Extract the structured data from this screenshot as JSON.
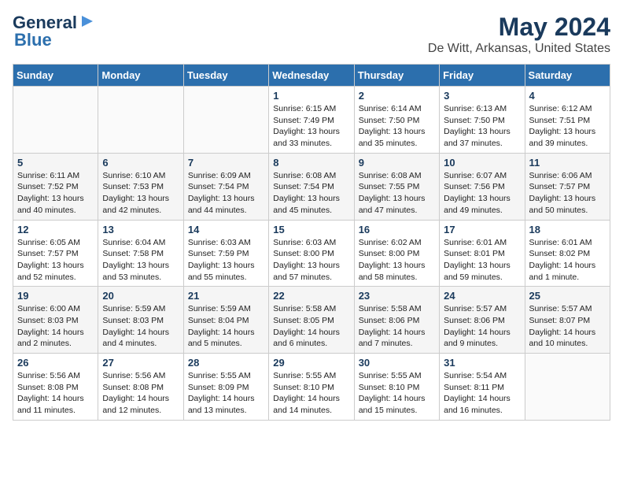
{
  "logo": {
    "line1": "General",
    "line2": "Blue"
  },
  "title": "May 2024",
  "subtitle": "De Witt, Arkansas, United States",
  "days_of_week": [
    "Sunday",
    "Monday",
    "Tuesday",
    "Wednesday",
    "Thursday",
    "Friday",
    "Saturday"
  ],
  "weeks": [
    [
      {
        "day": "",
        "info": ""
      },
      {
        "day": "",
        "info": ""
      },
      {
        "day": "",
        "info": ""
      },
      {
        "day": "1",
        "info": "Sunrise: 6:15 AM\nSunset: 7:49 PM\nDaylight: 13 hours\nand 33 minutes."
      },
      {
        "day": "2",
        "info": "Sunrise: 6:14 AM\nSunset: 7:50 PM\nDaylight: 13 hours\nand 35 minutes."
      },
      {
        "day": "3",
        "info": "Sunrise: 6:13 AM\nSunset: 7:50 PM\nDaylight: 13 hours\nand 37 minutes."
      },
      {
        "day": "4",
        "info": "Sunrise: 6:12 AM\nSunset: 7:51 PM\nDaylight: 13 hours\nand 39 minutes."
      }
    ],
    [
      {
        "day": "5",
        "info": "Sunrise: 6:11 AM\nSunset: 7:52 PM\nDaylight: 13 hours\nand 40 minutes."
      },
      {
        "day": "6",
        "info": "Sunrise: 6:10 AM\nSunset: 7:53 PM\nDaylight: 13 hours\nand 42 minutes."
      },
      {
        "day": "7",
        "info": "Sunrise: 6:09 AM\nSunset: 7:54 PM\nDaylight: 13 hours\nand 44 minutes."
      },
      {
        "day": "8",
        "info": "Sunrise: 6:08 AM\nSunset: 7:54 PM\nDaylight: 13 hours\nand 45 minutes."
      },
      {
        "day": "9",
        "info": "Sunrise: 6:08 AM\nSunset: 7:55 PM\nDaylight: 13 hours\nand 47 minutes."
      },
      {
        "day": "10",
        "info": "Sunrise: 6:07 AM\nSunset: 7:56 PM\nDaylight: 13 hours\nand 49 minutes."
      },
      {
        "day": "11",
        "info": "Sunrise: 6:06 AM\nSunset: 7:57 PM\nDaylight: 13 hours\nand 50 minutes."
      }
    ],
    [
      {
        "day": "12",
        "info": "Sunrise: 6:05 AM\nSunset: 7:57 PM\nDaylight: 13 hours\nand 52 minutes."
      },
      {
        "day": "13",
        "info": "Sunrise: 6:04 AM\nSunset: 7:58 PM\nDaylight: 13 hours\nand 53 minutes."
      },
      {
        "day": "14",
        "info": "Sunrise: 6:03 AM\nSunset: 7:59 PM\nDaylight: 13 hours\nand 55 minutes."
      },
      {
        "day": "15",
        "info": "Sunrise: 6:03 AM\nSunset: 8:00 PM\nDaylight: 13 hours\nand 57 minutes."
      },
      {
        "day": "16",
        "info": "Sunrise: 6:02 AM\nSunset: 8:00 PM\nDaylight: 13 hours\nand 58 minutes."
      },
      {
        "day": "17",
        "info": "Sunrise: 6:01 AM\nSunset: 8:01 PM\nDaylight: 13 hours\nand 59 minutes."
      },
      {
        "day": "18",
        "info": "Sunrise: 6:01 AM\nSunset: 8:02 PM\nDaylight: 14 hours\nand 1 minute."
      }
    ],
    [
      {
        "day": "19",
        "info": "Sunrise: 6:00 AM\nSunset: 8:03 PM\nDaylight: 14 hours\nand 2 minutes."
      },
      {
        "day": "20",
        "info": "Sunrise: 5:59 AM\nSunset: 8:03 PM\nDaylight: 14 hours\nand 4 minutes."
      },
      {
        "day": "21",
        "info": "Sunrise: 5:59 AM\nSunset: 8:04 PM\nDaylight: 14 hours\nand 5 minutes."
      },
      {
        "day": "22",
        "info": "Sunrise: 5:58 AM\nSunset: 8:05 PM\nDaylight: 14 hours\nand 6 minutes."
      },
      {
        "day": "23",
        "info": "Sunrise: 5:58 AM\nSunset: 8:06 PM\nDaylight: 14 hours\nand 7 minutes."
      },
      {
        "day": "24",
        "info": "Sunrise: 5:57 AM\nSunset: 8:06 PM\nDaylight: 14 hours\nand 9 minutes."
      },
      {
        "day": "25",
        "info": "Sunrise: 5:57 AM\nSunset: 8:07 PM\nDaylight: 14 hours\nand 10 minutes."
      }
    ],
    [
      {
        "day": "26",
        "info": "Sunrise: 5:56 AM\nSunset: 8:08 PM\nDaylight: 14 hours\nand 11 minutes."
      },
      {
        "day": "27",
        "info": "Sunrise: 5:56 AM\nSunset: 8:08 PM\nDaylight: 14 hours\nand 12 minutes."
      },
      {
        "day": "28",
        "info": "Sunrise: 5:55 AM\nSunset: 8:09 PM\nDaylight: 14 hours\nand 13 minutes."
      },
      {
        "day": "29",
        "info": "Sunrise: 5:55 AM\nSunset: 8:10 PM\nDaylight: 14 hours\nand 14 minutes."
      },
      {
        "day": "30",
        "info": "Sunrise: 5:55 AM\nSunset: 8:10 PM\nDaylight: 14 hours\nand 15 minutes."
      },
      {
        "day": "31",
        "info": "Sunrise: 5:54 AM\nSunset: 8:11 PM\nDaylight: 14 hours\nand 16 minutes."
      },
      {
        "day": "",
        "info": ""
      }
    ]
  ]
}
